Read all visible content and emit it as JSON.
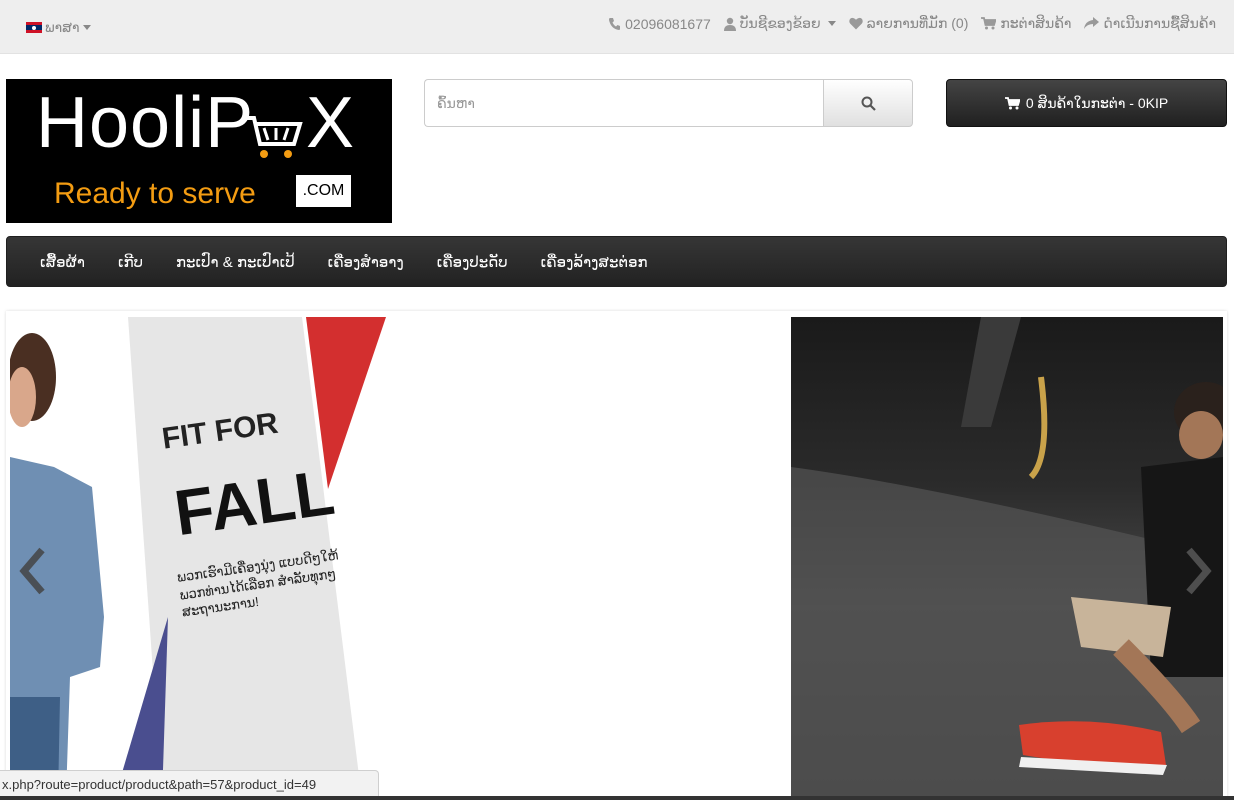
{
  "topbar": {
    "language_label": "ພາສາ",
    "phone": "02096081677",
    "account_label": "ບັນຊີຂອງຂ້ອຍ",
    "wishlist_label": "ລາຍການທີ່ມັກ (0)",
    "cart_label": "ກະຕ່າສິນຄ້າ",
    "checkout_label": "ດຳເນີນການຊື້ສິນຄ້າ"
  },
  "logo": {
    "text_left": "HooliP",
    "text_right": "X",
    "tagline": "Ready to serve",
    "domain": ".COM"
  },
  "search": {
    "placeholder": "ຄົ້ນຫາ"
  },
  "cart_button": {
    "label": "0 ສິນຄ້າໃນກະຕ່າ - 0KIP"
  },
  "nav": {
    "items": [
      {
        "label": "ເສື້ອຜ້າ"
      },
      {
        "label": "ເກີບ"
      },
      {
        "label": "ກະເປົາ & ກະເປົາເປ້"
      },
      {
        "label": "ເຄື່ອງສຳອາງ"
      },
      {
        "label": "ເຄື່ອງປະດັບ"
      },
      {
        "label": "ເຄື່ອງລ້າງສະຕ່ອກ"
      }
    ]
  },
  "slider": {
    "banner_line1": "FIT FOR",
    "banner_line2": "FALL",
    "banner_text": "ພວກເຮົາມີເຄື່ອງນຸ່ງ ແບບດີໆໃຫ້ພວກທ່ານໄດ້ເລືອກ ສຳລັບທຸກໆສະຖານະການ!"
  },
  "status_url": "x.php?route=product/product&path=57&product_id=49",
  "colors": {
    "topbar_bg": "#eeeeee",
    "nav_bg": "#2a2a2a",
    "logo_accent": "#f39c12",
    "banner_red": "#d32f2f",
    "banner_blue": "#4a4e8f"
  },
  "icons": {
    "phone": "phone-icon",
    "account": "user-icon",
    "wishlist": "heart-icon",
    "cart": "cart-icon",
    "checkout": "share-icon",
    "search": "search-icon"
  }
}
